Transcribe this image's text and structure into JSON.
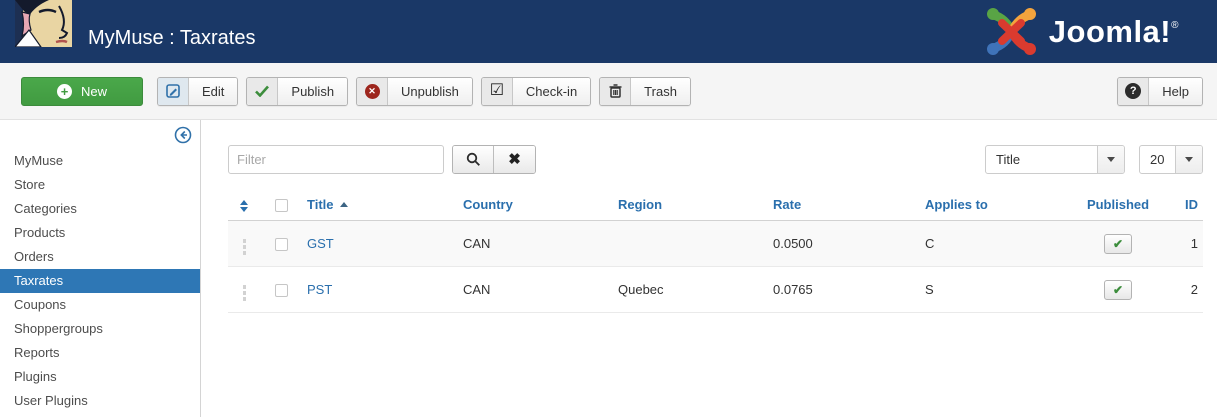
{
  "header": {
    "app_title": "MyMuse : Taxrates",
    "logo_text": "Joomla!",
    "logo_reg": "®"
  },
  "toolbar": {
    "new_label": "New",
    "edit_label": "Edit",
    "publish_label": "Publish",
    "unpublish_label": "Unpublish",
    "checkin_label": "Check-in",
    "trash_label": "Trash",
    "help_label": "Help"
  },
  "sidebar": {
    "items": [
      {
        "label": "MyMuse"
      },
      {
        "label": "Store"
      },
      {
        "label": "Categories"
      },
      {
        "label": "Products"
      },
      {
        "label": "Orders"
      },
      {
        "label": "Taxrates",
        "active": true
      },
      {
        "label": "Coupons"
      },
      {
        "label": "Shoppergroups"
      },
      {
        "label": "Reports"
      },
      {
        "label": "Plugins"
      },
      {
        "label": "User Plugins"
      }
    ]
  },
  "filter_bar": {
    "filter_placeholder": "Filter",
    "sort_select_value": "Title",
    "limit_select_value": "20"
  },
  "table": {
    "headers": {
      "title": "Title",
      "country": "Country",
      "region": "Region",
      "rate": "Rate",
      "applies_to": "Applies to",
      "published": "Published",
      "id": "ID"
    },
    "rows": [
      {
        "title": "GST",
        "country": "CAN",
        "region": "",
        "rate": "0.0500",
        "applies_to": "C",
        "published": "yes",
        "id": "1"
      },
      {
        "title": "PST",
        "country": "CAN",
        "region": "Quebec",
        "rate": "0.0765",
        "applies_to": "S",
        "published": "yes",
        "id": "2"
      }
    ]
  },
  "icons": {
    "plus_glyph": "+",
    "unpublish_x_glyph": "✕",
    "checkin_glyph": "☑",
    "help_glyph": "?",
    "clear_glyph": "✖",
    "published_check_glyph": "✔"
  },
  "colors": {
    "header_bg": "#1a3867",
    "accent_blue": "#2a6fad",
    "sidebar_active_bg": "#2e77b5",
    "new_button_green": "#46a546",
    "publish_check_green": "#3c8d3c",
    "unpublish_red": "#9d261d"
  }
}
